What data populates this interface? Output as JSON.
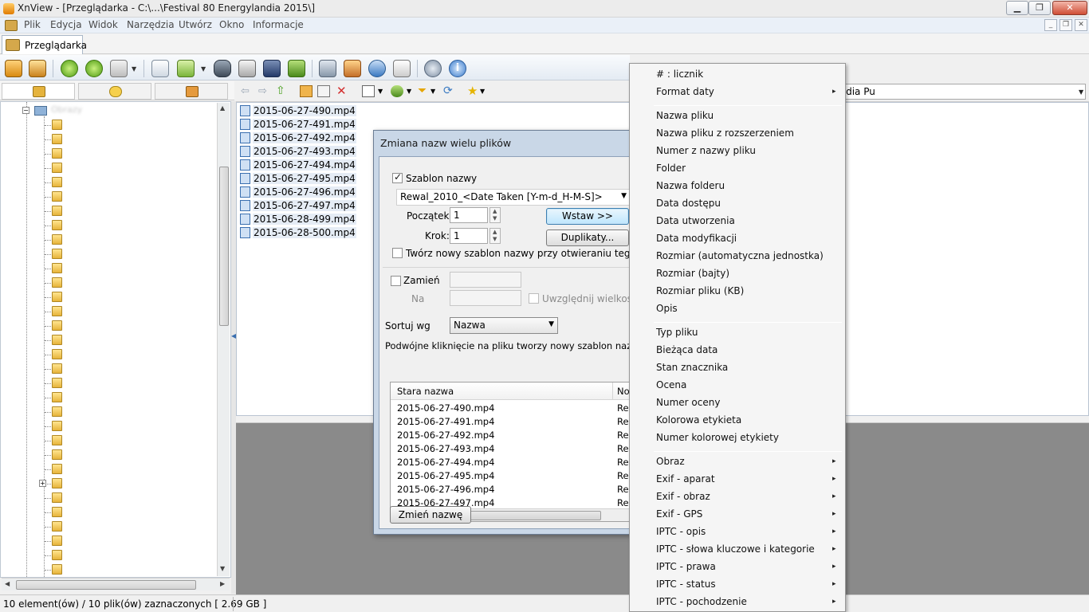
{
  "window": {
    "title": "XnView - [Przeglądarka - C:\\...\\Festival 80 Energylandia 2015\\]",
    "min_label": "▁",
    "max_label": "❐",
    "close_label": "✕"
  },
  "menubar": {
    "items": [
      "Plik",
      "Edycja",
      "Widok",
      "Narzędzia",
      "Utwórz",
      "Okno",
      "Informacje"
    ]
  },
  "tabs": {
    "browser_label": "Przeglądarka"
  },
  "navbar": {
    "path": "C:\\Users\\Public\\Multimedia Pu"
  },
  "tree": {
    "root_label": "Obrazy"
  },
  "files": [
    "2015-06-27-490.mp4",
    "2015-06-27-491.mp4",
    "2015-06-27-492.mp4",
    "2015-06-27-493.mp4",
    "2015-06-27-494.mp4",
    "2015-06-27-495.mp4",
    "2015-06-27-496.mp4",
    "2015-06-27-497.mp4",
    "2015-06-28-499.mp4",
    "2015-06-28-500.mp4"
  ],
  "status": {
    "text": "10 element(ów) / 10 plik(ów) zaznaczonych  [ 2.69 GB ]"
  },
  "dialog": {
    "title": "Zmiana nazw wielu plików",
    "template_checkbox_label": "Szablon nazwy",
    "template_value": "Rewal_2010_<Date Taken [Y-m-d_H-M-S]>",
    "start_label": "Początek:",
    "start_value": "1",
    "step_label": "Krok:",
    "step_value": "1",
    "insert_button": "Wstaw >>",
    "duplicates_button": "Duplikaty...",
    "new_template_checkbox_label": "Twórz nowy szablon nazwy przy otwieraniu tego okna",
    "replace_checkbox_label": "Zamień",
    "to_label": "Na",
    "case_checkbox_label": "Uwzględnij wielkość lite",
    "sort_label": "Sortuj wg",
    "sort_value": "Nazwa",
    "hint": "Podwójne kliknięcie na pliku tworzy nowy szablon nazwy pliku",
    "col_old": "Stara nazwa",
    "col_new": "Now",
    "rows": [
      {
        "old": "2015-06-27-490.mp4",
        "new": "Rew"
      },
      {
        "old": "2015-06-27-491.mp4",
        "new": "Rew"
      },
      {
        "old": "2015-06-27-492.mp4",
        "new": "Rew"
      },
      {
        "old": "2015-06-27-493.mp4",
        "new": "Rew"
      },
      {
        "old": "2015-06-27-494.mp4",
        "new": "Rew"
      },
      {
        "old": "2015-06-27-495.mp4",
        "new": "Rew"
      },
      {
        "old": "2015-06-27-496.mp4",
        "new": "Rew"
      },
      {
        "old": "2015-06-27-497.mp4",
        "new": "Rew"
      }
    ],
    "rename_button": "Zmień nazwę"
  },
  "context_menu": {
    "items": [
      {
        "label": "# : licznik",
        "submenu": false
      },
      {
        "label": "Format daty",
        "submenu": true
      },
      {
        "sep": true
      },
      {
        "label": "Nazwa pliku",
        "submenu": false
      },
      {
        "label": "Nazwa pliku z rozszerzeniem",
        "submenu": false
      },
      {
        "label": "Numer z nazwy pliku",
        "submenu": false
      },
      {
        "label": "Folder",
        "submenu": false
      },
      {
        "label": "Nazwa folderu",
        "submenu": false
      },
      {
        "label": "Data dostępu",
        "submenu": false
      },
      {
        "label": "Data utworzenia",
        "submenu": false
      },
      {
        "label": "Data modyfikacji",
        "submenu": false
      },
      {
        "label": "Rozmiar (automatyczna jednostka)",
        "submenu": false
      },
      {
        "label": "Rozmiar (bajty)",
        "submenu": false
      },
      {
        "label": "Rozmiar pliku (KB)",
        "submenu": false
      },
      {
        "label": "Opis",
        "submenu": false
      },
      {
        "sep": true
      },
      {
        "label": "Typ pliku",
        "submenu": false
      },
      {
        "label": "Bieżąca data",
        "submenu": false
      },
      {
        "label": "Stan znacznika",
        "submenu": false
      },
      {
        "label": "Ocena",
        "submenu": false
      },
      {
        "label": "Numer oceny",
        "submenu": false
      },
      {
        "label": "Kolorowa etykieta",
        "submenu": false
      },
      {
        "label": "Numer kolorowej etykiety",
        "submenu": false
      },
      {
        "sep": true
      },
      {
        "label": "Obraz",
        "submenu": true
      },
      {
        "label": "Exif - aparat",
        "submenu": true
      },
      {
        "label": "Exif - obraz",
        "submenu": true
      },
      {
        "label": "Exif - GPS",
        "submenu": true
      },
      {
        "label": "IPTC - opis",
        "submenu": true
      },
      {
        "label": "IPTC - słowa kluczowe i kategorie",
        "submenu": true
      },
      {
        "label": "IPTC - prawa",
        "submenu": true
      },
      {
        "label": "IPTC - status",
        "submenu": true
      },
      {
        "label": "IPTC - pochodzenie",
        "submenu": true
      }
    ]
  },
  "colors": {
    "preview_bg": "#8a8a8a",
    "selection": "#e5ecf5",
    "dialog_frame": "#c9d7e7"
  },
  "icons": {
    "submenu_arrow": "▸",
    "dropdown_arrow": "▼",
    "spin_up": "▲",
    "spin_down": "▼"
  }
}
